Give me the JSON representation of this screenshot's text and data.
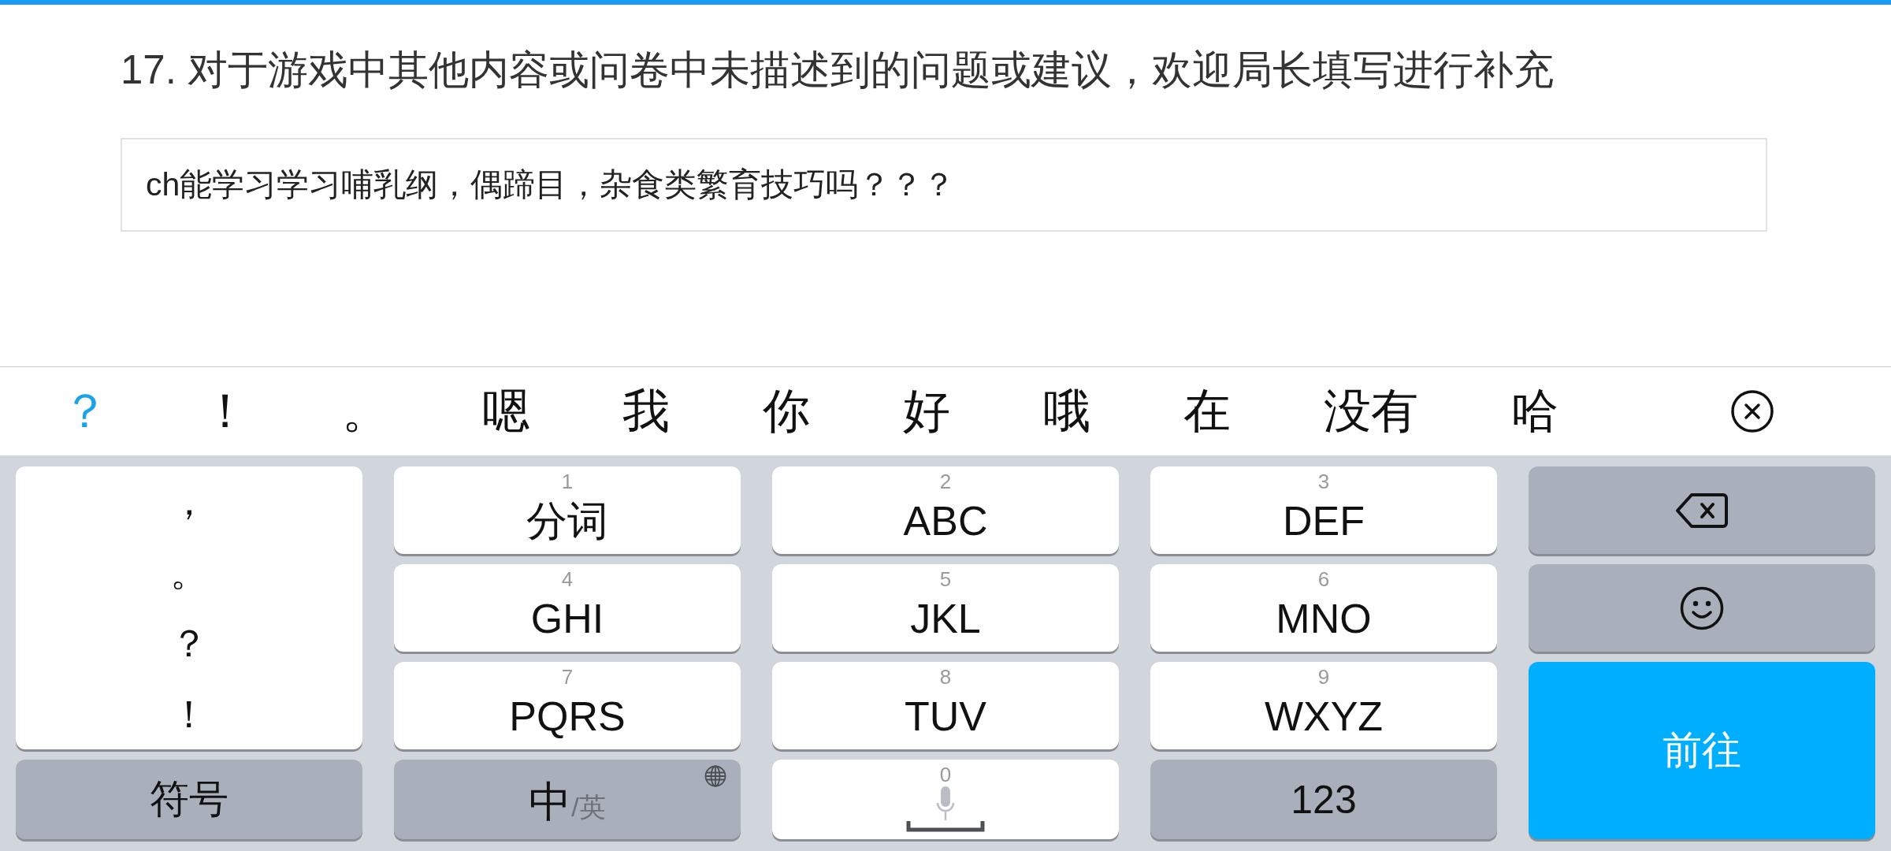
{
  "question": {
    "title": "17. 对于游戏中其他内容或问卷中未描述到的问题或建议，欢迎局长填写进行补充"
  },
  "answer_field": {
    "value": "ch能学习学习哺乳纲，偶蹄目，杂食类繁育技巧吗？？？"
  },
  "candidate_bar": {
    "candidates": [
      {
        "text": "？",
        "selected": true
      },
      {
        "text": "！",
        "selected": false
      },
      {
        "text": "。",
        "selected": false
      },
      {
        "text": "嗯",
        "selected": false
      },
      {
        "text": "我",
        "selected": false
      },
      {
        "text": "你",
        "selected": false
      },
      {
        "text": "好",
        "selected": false
      },
      {
        "text": "哦",
        "selected": false
      },
      {
        "text": "在",
        "selected": false
      },
      {
        "text": "没有",
        "selected": false
      },
      {
        "text": "哈",
        "selected": false
      }
    ]
  },
  "keyboard": {
    "keys": [
      {
        "kind": "punctuation",
        "marks": [
          "，",
          "。",
          "？",
          "！"
        ]
      },
      {
        "kind": "digit",
        "number": "1",
        "label": "分词"
      },
      {
        "kind": "digit",
        "number": "2",
        "label": "ABC"
      },
      {
        "kind": "digit",
        "number": "3",
        "label": "DEF"
      },
      {
        "kind": "backspace"
      },
      {
        "kind": "digit",
        "number": "4",
        "label": "GHI"
      },
      {
        "kind": "digit",
        "number": "5",
        "label": "JKL"
      },
      {
        "kind": "digit",
        "number": "6",
        "label": "MNO"
      },
      {
        "kind": "emoji"
      },
      {
        "kind": "digit",
        "number": "7",
        "label": "PQRS"
      },
      {
        "kind": "digit",
        "number": "8",
        "label": "TUV"
      },
      {
        "kind": "digit",
        "number": "9",
        "label": "WXYZ"
      },
      {
        "kind": "enter",
        "label": "前往"
      },
      {
        "kind": "function",
        "label": "符号"
      },
      {
        "kind": "language",
        "options": [
          {
            "label": "中",
            "selected": true
          },
          {
            "label": "/英",
            "selected": false
          }
        ]
      },
      {
        "kind": "space",
        "number": "0"
      },
      {
        "kind": "function",
        "label": "123"
      }
    ]
  }
}
